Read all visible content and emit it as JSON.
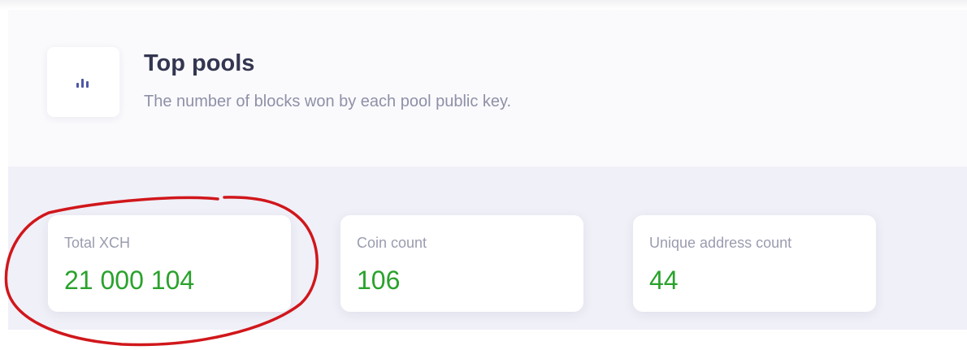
{
  "colors": {
    "title": "#343650",
    "subtitle": "#8e90a6",
    "label": "#9a9caf",
    "value": "#2aa22c",
    "icon": "#4e57a8",
    "annotation": "#d0171b"
  },
  "header": {
    "icon": "bar-chart-icon",
    "title": "Top pools",
    "subtitle": "The number of blocks won by each pool public key."
  },
  "stats": [
    {
      "label": "Total XCH",
      "value": "21 000 104"
    },
    {
      "label": "Coin count",
      "value": "106"
    },
    {
      "label": "Unique address count",
      "value": "44"
    }
  ],
  "annotation": {
    "shape": "freehand-ellipse",
    "target": "Total XCH"
  }
}
